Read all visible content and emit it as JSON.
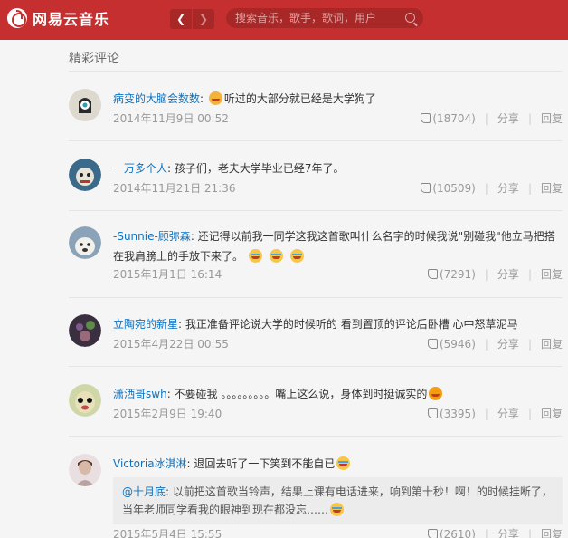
{
  "app": {
    "name": "网易云音乐"
  },
  "search": {
    "placeholder": "搜索音乐，歌手，歌词，用户"
  },
  "section": {
    "title": "精彩评论"
  },
  "actions": {
    "share": "分享",
    "reply": "回复"
  },
  "colors": {
    "brand": "#c62f2f",
    "link": "#0c73c2",
    "muted": "#999999"
  },
  "comments": [
    {
      "user": "病变的大脑会数数",
      "text": "听过的大部分就已经是大学狗了",
      "emojis": [
        "smile"
      ],
      "time": "2014年11月9日 00:52",
      "likes": "(18704)"
    },
    {
      "user": "一万多个人",
      "text": "孩子们，老夫大学毕业已经7年了。",
      "emojis": [],
      "time": "2014年11月21日 21:36",
      "likes": "(10509)"
    },
    {
      "user": "-Sunnie-顾弥森",
      "text": "还记得以前我一同学这我这首歌叫什么名字的时候我说\"别碰我\"他立马把搭在我肩膀上的手放下来了。",
      "emojis": [
        "cry",
        "cry",
        "cry"
      ],
      "time": "2015年1月1日 16:14",
      "likes": "(7291)"
    },
    {
      "user": "立陶宛的新星",
      "text": "我正准备评论说大学的时候听的 看到置顶的评论后卧槽 心中怒草泥马",
      "emojis": [],
      "time": "2015年4月22日 00:55",
      "likes": "(5946)"
    },
    {
      "user": "潇洒哥swh",
      "text": "不要碰我 。。。。。。。。。嘴上这么说，身体到时挺诚实的",
      "emojis": [
        "blush"
      ],
      "time": "2015年2月9日 19:40",
      "likes": "(3395)"
    },
    {
      "user": "Victoria冰淇淋",
      "text": "退回去听了一下笑到不能自已",
      "emojis": [
        "cry"
      ],
      "time": "2015年5月4日 15:55",
      "likes": "(2610)",
      "quote": {
        "user": "@十月底",
        "text": "以前把这首歌当铃声，结果上课有电话进来，响到第十秒！啊！的时候挂断了，当年老师同学看我的眼神到现在都没忘……",
        "emojis": [
          "cry"
        ]
      }
    }
  ]
}
